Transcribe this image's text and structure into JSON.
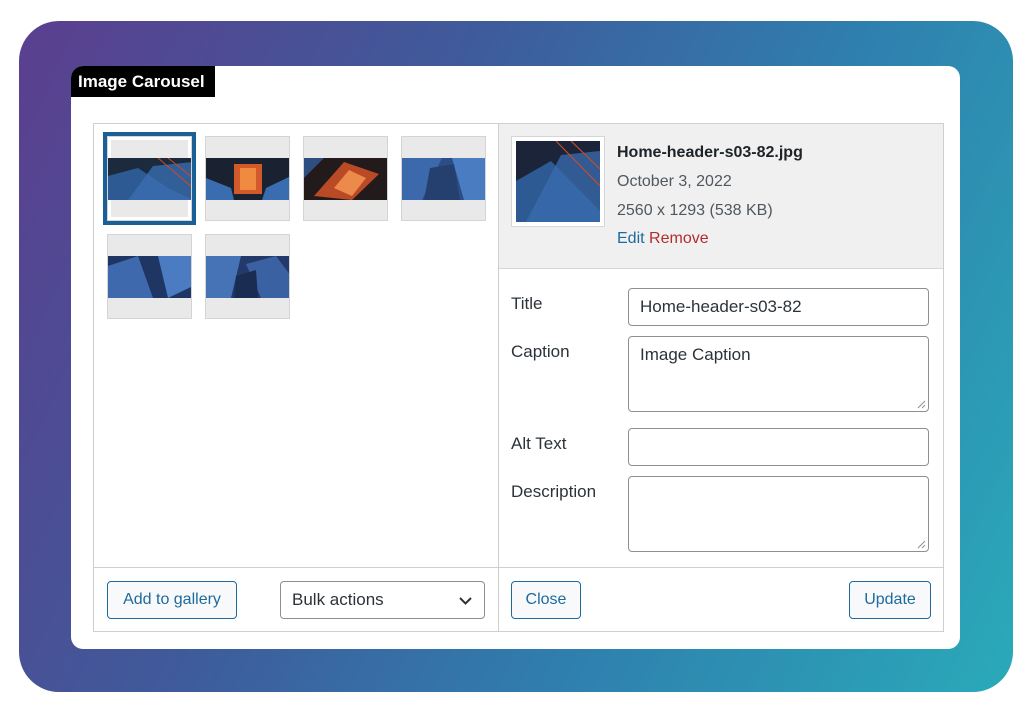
{
  "widget_title": "Image Carousel",
  "gallery": {
    "thumbnails": [
      {
        "name": "thumb-1",
        "selected": true
      },
      {
        "name": "thumb-2",
        "selected": false
      },
      {
        "name": "thumb-3",
        "selected": false
      },
      {
        "name": "thumb-4",
        "selected": false
      },
      {
        "name": "thumb-5",
        "selected": false
      },
      {
        "name": "thumb-6",
        "selected": false
      }
    ],
    "add_button": "Add to gallery",
    "bulk_select": {
      "value": "Bulk actions",
      "icon": "chevron-down-icon"
    }
  },
  "details": {
    "filename": "Home-header-s03-82.jpg",
    "date": "October 3, 2022",
    "dimensions": "2560 x 1293 (538 KB)",
    "edit_link": "Edit",
    "remove_link": "Remove",
    "fields": {
      "title_label": "Title",
      "title_value": "Home-header-s03-82",
      "caption_label": "Caption",
      "caption_value": "Image Caption",
      "alt_label": "Alt Text",
      "alt_value": "",
      "description_label": "Description",
      "description_value": ""
    },
    "close_button": "Close",
    "update_button": "Update"
  },
  "colors": {
    "accent": "#1e6a9c",
    "remove": "#b32d2e",
    "selection": "#1a5f95"
  }
}
